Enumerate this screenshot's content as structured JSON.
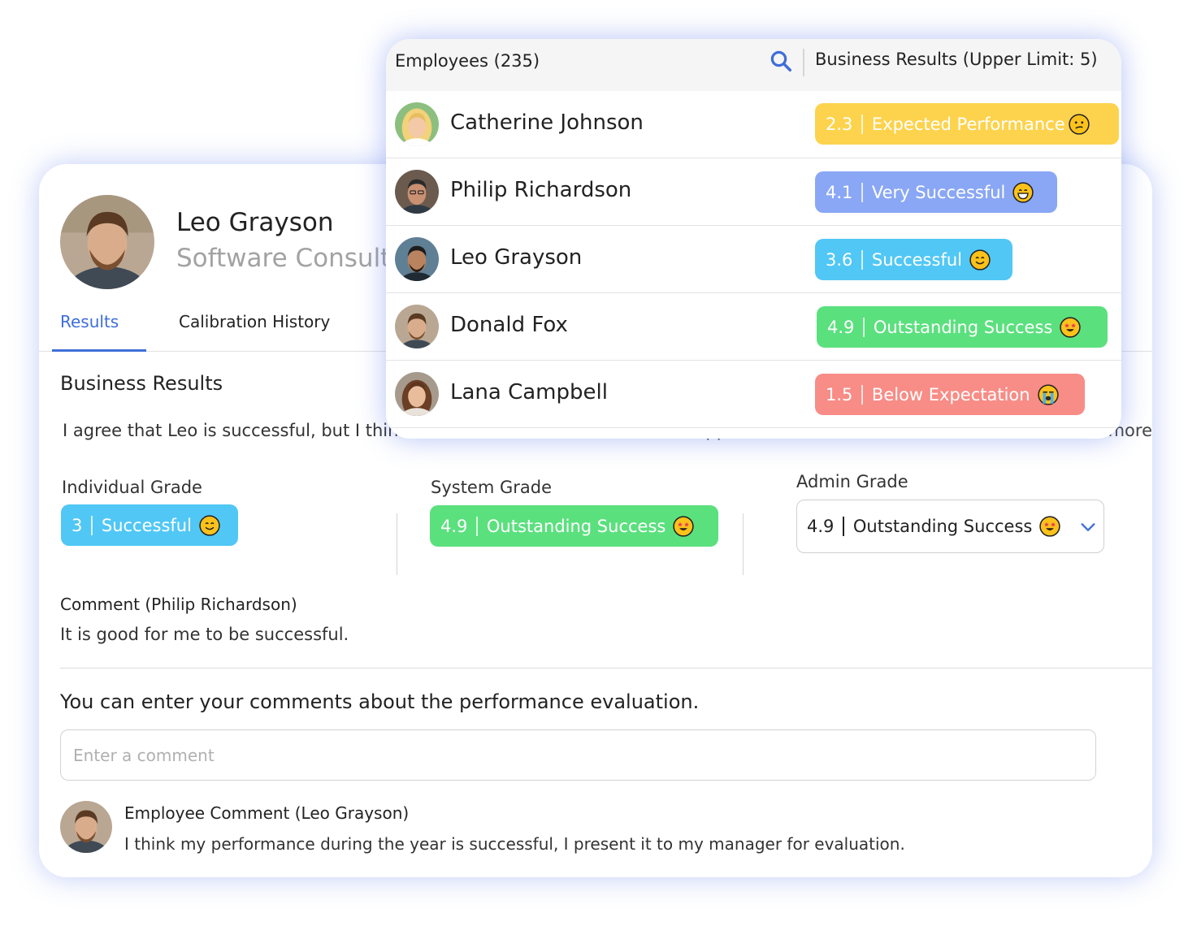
{
  "profile": {
    "name": "Leo Grayson",
    "title": "Software Consultant",
    "tabs": [
      "Results",
      "Calibration History"
    ],
    "section_title": "Business Results",
    "description": "I agree that Leo is successful, but I think he should be evaluated with the upper limit in mind.",
    "more_label": "more",
    "individual_grade": {
      "label": "Individual Grade",
      "score": "3",
      "text": "Successful",
      "emoji": "smile",
      "color": "#51c7f5"
    },
    "system_grade": {
      "label": "System Grade",
      "score": "4.9",
      "text": "Outstanding Success",
      "emoji": "star-eyes",
      "color": "#5be07e"
    },
    "admin_grade": {
      "label": "Admin Grade",
      "score": "4.9",
      "text": "Outstanding Success",
      "emoji": "star-eyes"
    },
    "manager_comment": {
      "label": "Comment (Philip Richardson)",
      "text": "It is good for me to be successful."
    },
    "prompt": "You can enter your comments about the performance evaluation.",
    "comment_placeholder": "Enter a comment",
    "employee_comment": {
      "label": "Employee Comment (Leo Grayson)",
      "text": "I think my performance during the year is successful, I present it to my manager for evaluation."
    }
  },
  "popup": {
    "title": "Employees (235)",
    "column": "Business Results (Upper Limit: 5)",
    "employees": [
      {
        "name": "Catherine Johnson",
        "score": "2.3",
        "label": "Expected Performance",
        "emoji": "confused",
        "color": "#fdd34e"
      },
      {
        "name": "Philip Richardson",
        "score": "4.1",
        "label": "Very Successful",
        "emoji": "grin",
        "color": "#8aa7f5"
      },
      {
        "name": "Leo Grayson",
        "score": "3.6",
        "label": "Successful",
        "emoji": "smile",
        "color": "#51c7f5"
      },
      {
        "name": "Donald Fox",
        "score": "4.9",
        "label": "Outstanding Success",
        "emoji": "star-eyes",
        "color": "#5be07e"
      },
      {
        "name": "Lana Campbell",
        "score": "1.5",
        "label": "Below Expectation",
        "emoji": "crying",
        "color": "#f88c86"
      }
    ]
  }
}
